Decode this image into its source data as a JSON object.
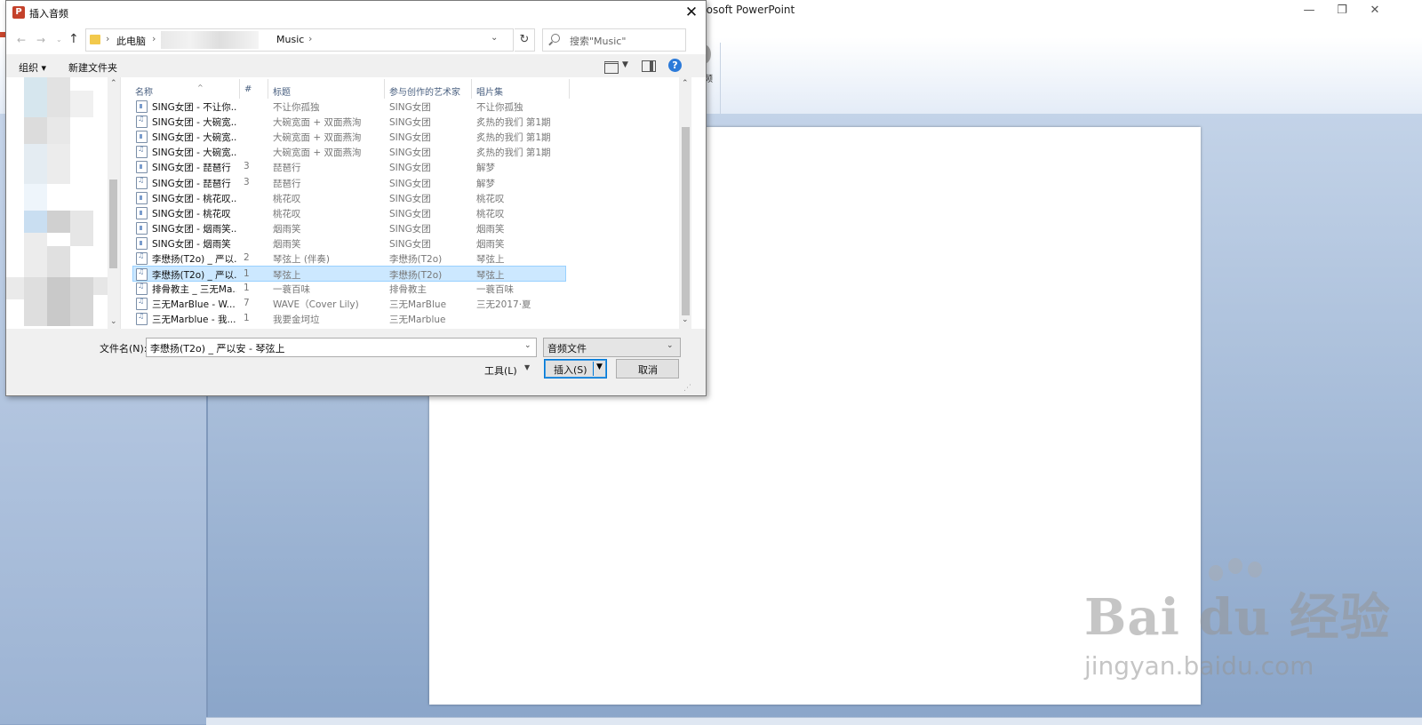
{
  "ppt": {
    "title": "rosoft PowerPoint",
    "minimize": "—",
    "restore": "❐",
    "close": "✕",
    "help": "?",
    "collapse": "^",
    "ribbon_label": "频"
  },
  "dialog": {
    "title": "插入音频",
    "app_icon": "P",
    "close": "✕",
    "address": {
      "crumbs": [
        "此电脑",
        "Music"
      ],
      "separator": "›"
    },
    "search_placeholder": "搜索\"Music\"",
    "toolbar": {
      "organize": "组织 ▾",
      "new_folder": "新建文件夹",
      "help": "?"
    },
    "columns": [
      "名称",
      "#",
      "标题",
      "参与创作的艺术家",
      "唱片集"
    ],
    "files": [
      {
        "name": "SING女团 - 不让你...",
        "num": "",
        "title": "不让你孤独",
        "artist": "SING女团",
        "album": "不让你孤独",
        "icon": "doc"
      },
      {
        "name": "SING女团 - 大碗宽...",
        "num": "",
        "title": "大碗宽面 + 双面燕洵",
        "artist": "SING女团",
        "album": "炙热的我们 第1期",
        "icon": "mp3"
      },
      {
        "name": "SING女团 - 大碗宽...",
        "num": "",
        "title": "大碗宽面 + 双面燕洵",
        "artist": "SING女团",
        "album": "炙热的我们 第1期",
        "icon": "doc"
      },
      {
        "name": "SING女团 - 大碗宽...",
        "num": "",
        "title": "大碗宽面 + 双面燕洵",
        "artist": "SING女团",
        "album": "炙热的我们 第1期",
        "icon": "mp3"
      },
      {
        "name": "SING女团 - 琵琶行",
        "num": "3",
        "title": "琵琶行",
        "artist": "SING女团",
        "album": "解梦",
        "icon": "doc"
      },
      {
        "name": "SING女团 - 琵琶行",
        "num": "3",
        "title": "琵琶行",
        "artist": "SING女团",
        "album": "解梦",
        "icon": "mp3"
      },
      {
        "name": "SING女团 - 桃花叹...",
        "num": "",
        "title": "桃花叹",
        "artist": "SING女团",
        "album": "桃花叹",
        "icon": "doc"
      },
      {
        "name": "SING女团 - 桃花叹",
        "num": "",
        "title": "桃花叹",
        "artist": "SING女团",
        "album": "桃花叹",
        "icon": "doc"
      },
      {
        "name": "SING女团 - 烟雨笑...",
        "num": "",
        "title": "烟雨笑",
        "artist": "SING女团",
        "album": "烟雨笑",
        "icon": "doc"
      },
      {
        "name": "SING女团 - 烟雨笑",
        "num": "",
        "title": "烟雨笑",
        "artist": "SING女团",
        "album": "烟雨笑",
        "icon": "doc"
      },
      {
        "name": "李懋扬(T2o) _ 严以...",
        "num": "2",
        "title": "琴弦上 (伴奏)",
        "artist": "李懋扬(T2o)",
        "album": "琴弦上",
        "icon": "mp3"
      },
      {
        "name": "李懋扬(T2o) _ 严以...",
        "num": "1",
        "title": "琴弦上",
        "artist": "李懋扬(T2o)",
        "album": "琴弦上",
        "icon": "mp3"
      },
      {
        "name": "排骨教主 _ 三无Ma...",
        "num": "1",
        "title": "一蓑百味",
        "artist": "排骨教主",
        "album": "一蓑百味",
        "icon": "mp3"
      },
      {
        "name": "三无MarBlue - W...",
        "num": "7",
        "title": "WAVE（Cover Lily)",
        "artist": "三无MarBlue",
        "album": "三无2017·夏",
        "icon": "mp3"
      },
      {
        "name": "三无Marblue - 我...",
        "num": "1",
        "title": "我要金坷垃",
        "artist": "三无Marblue",
        "album": "",
        "icon": "mp3"
      }
    ],
    "selected_index": 11,
    "filename_label": "文件名(N):",
    "filename_value": "李懋扬(T2o) _ 严以安 - 琴弦上",
    "filetype_value": "音频文件",
    "tools_label": "工具(L)",
    "insert_label": "插入(S)",
    "cancel_label": "取消"
  },
  "watermark": {
    "main": "Bai du 经验",
    "sub": "jingyan.baidu.com"
  },
  "colors": {
    "selection": "#cce8ff",
    "accent": "#0078d7",
    "workspace": "#8ea6c8"
  }
}
